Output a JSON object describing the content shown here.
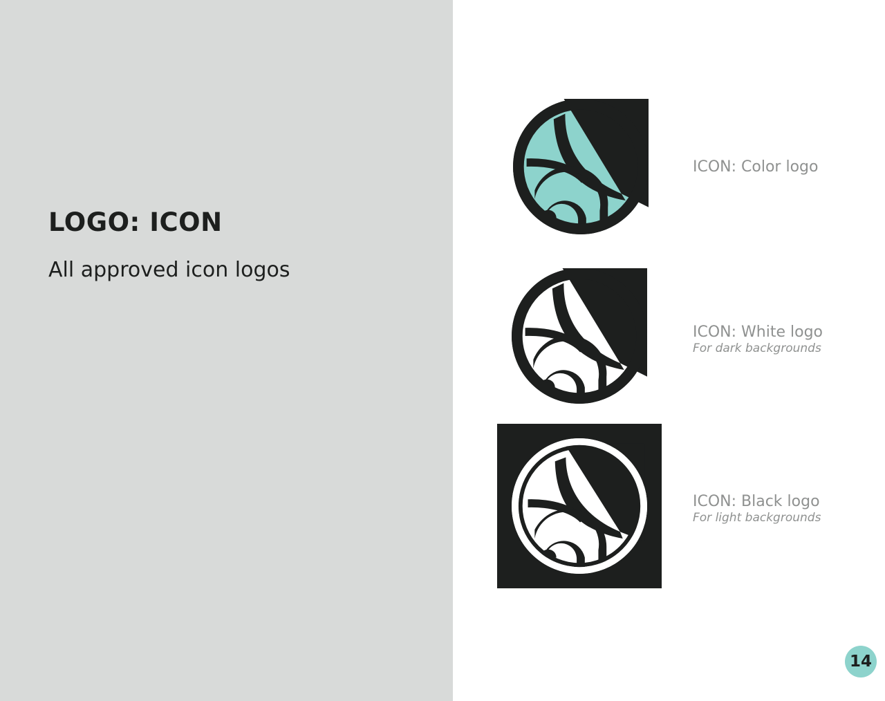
{
  "heading": {
    "title": "LOGO: ICON",
    "subtitle": "All approved icon logos"
  },
  "logos": [
    {
      "icon": "color-logo-icon",
      "label": "ICON: Color logo",
      "note": "",
      "ring_color": "#1d1f1e",
      "fill_color": "#8dd3cc"
    },
    {
      "icon": "white-logo-icon",
      "label": "ICON: White logo",
      "note": "For dark backgrounds",
      "ring_color": "#1d1f1e",
      "fill_color": "#ffffff"
    },
    {
      "icon": "black-logo-icon",
      "label": "ICON: Black logo",
      "note": "For light backgrounds",
      "ring_color": "#1d1f1e",
      "fill_color": "#ffffff"
    }
  ],
  "page_number": "14",
  "colors": {
    "panel": "#d8dad9",
    "accent": "#8dd3cc",
    "ink": "#1d1f1e",
    "caption": "#8f9190"
  }
}
